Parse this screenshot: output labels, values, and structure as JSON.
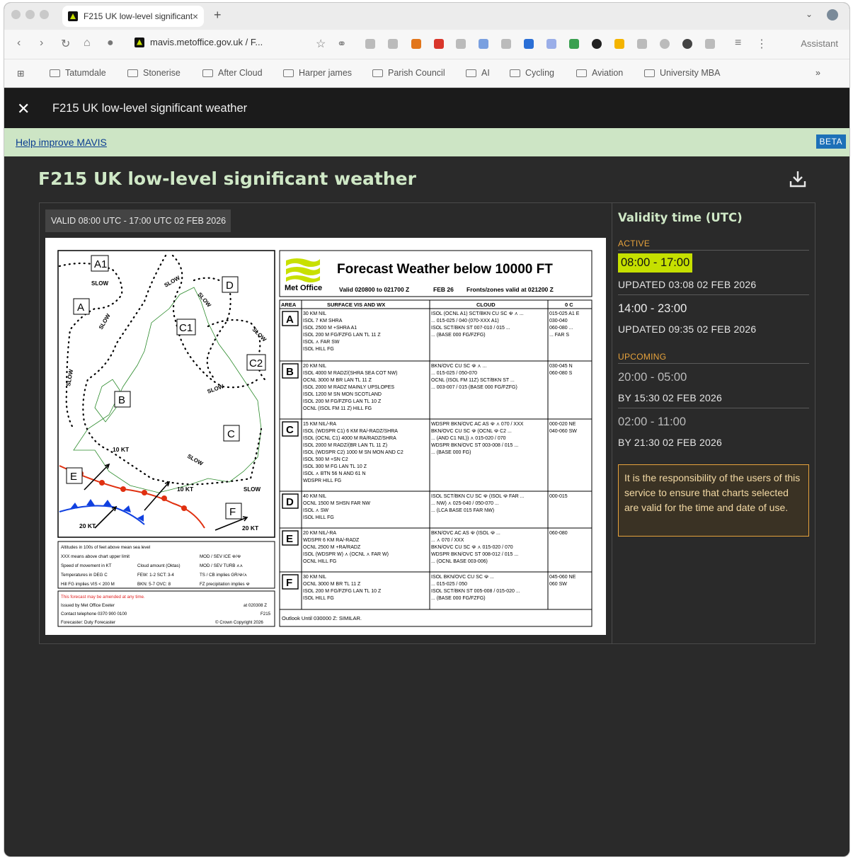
{
  "browser": {
    "tab_title": "F215 UK low-level significant",
    "url": "mavis.metoffice.gov.uk / F...",
    "assistant_label": "Assistant",
    "bookmarks": [
      "Tatumdale",
      "Stonerise",
      "After Cloud",
      "Harper james",
      "Parish Council",
      "AI",
      "Cycling",
      "Aviation",
      "University MBA"
    ]
  },
  "appbar": {
    "title": "F215 UK low-level significant weather"
  },
  "help": {
    "link": "Help improve MAVIS",
    "beta": "BETA"
  },
  "page": {
    "title": "F215 UK low-level significant weather"
  },
  "chart": {
    "valid_badge": "VALID 08:00 UTC - 17:00 UTC 02 FEB 2026",
    "header_title": "Forecast Weather below 10000 FT",
    "logo_text": "Met Office",
    "valid_line": "Valid 020800 to 021700 Z",
    "date_code": "FEB 26",
    "fronts_line": "Fronts/zones valid at 021200 Z",
    "col_area": "AREA",
    "col_vis": "SURFACE VIS AND WX",
    "col_cloud": "CLOUD",
    "col_zero": "0 C",
    "rows": [
      {
        "area": "A",
        "vis": [
          "30 KM NIL",
          "ISOL 7 KM SHRA",
          "ISOL 2500 M +SHRA A1",
          "ISOL 200 M FG/FZFG LAN TL 11 Z",
          "ISOL ⋏ FAR SW",
          "ISOL HILL FG"
        ],
        "cloud": [
          "ISOL (OCNL A1) SCT/BKN CU SC ☫ ⋏ ...",
          "... 015-025 / 040 (070-XXX A1)",
          "ISOL SCT/BKN ST 007-010 / 015 ...",
          "... (BASE 000 FG/FZFG)"
        ],
        "zero": [
          "015-025 A1 E",
          "030-040",
          "060-080 ...",
          "... FAR S"
        ]
      },
      {
        "area": "B",
        "vis": [
          "20 KM NIL",
          "ISOL 4000 M RADZ/(SHRA SEA COT NW)",
          "OCNL 3000 M BR LAN TL 11 Z",
          "ISOL 2000 M RADZ MAINLY UPSLOPES",
          "ISOL 1200 M SN MON SCOTLAND",
          "ISOL 200 M FG/FZFG LAN TL 10 Z",
          "OCNL (ISOL FM 11 Z) HILL FG"
        ],
        "cloud": [
          "BKN/OVC CU SC ☫ ⋏ ...",
          "... 015-025 / 050-070",
          "OCNL (ISOL FM 11Z) SCT/BKN ST ...",
          "... 003-007 / 015 (BASE 000 FG/FZFG)"
        ],
        "zero": [
          "030-045 N",
          "060-080 S"
        ]
      },
      {
        "area": "C",
        "vis": [
          "15 KM NIL/-RA",
          "ISOL (WDSPR C1) 6 KM RA/-RADZ/SHRA",
          "ISOL (OCNL C1) 4000 M RA/RADZ/SHRA",
          "ISOL 2000 M RADZ/(BR LAN TL 11 Z)",
          "ISOL (WDSPR C2) 1000 M SN MON AND C2",
          "ISOL 500 M +SN C2",
          "ISOL 300 M FG LAN TL 10 Z",
          "ISOL ⋏ BTN 56 N AND 61 N",
          "WDSPR HILL FG"
        ],
        "cloud": [
          "WDSPR BKN/OVC AC AS ☫ ⋏ 070 / XXX",
          "BKN/OVC CU SC ☫ (OCNL ☫ C2 ...",
          "... (AND C1 NIL)) ⋏ 015-020 / 070",
          "WDSPR BKN/OVC ST 003-008 / 015 ...",
          "... (BASE 000 FG)"
        ],
        "zero": [
          "000-020 NE",
          "040-060 SW"
        ]
      },
      {
        "area": "D",
        "vis": [
          "40 KM NIL",
          "OCNL 1500 M SHSN FAR NW",
          "ISOL ⋏ SW",
          "ISOL HILL FG"
        ],
        "cloud": [
          "ISOL SCT/BKN CU SC ☫ (ISOL ☫ FAR ...",
          "... NW) ⋏ 025-040 / 050-070 ...",
          "... (LCA BASE 015 FAR NW)"
        ],
        "zero": [
          "000-015"
        ]
      },
      {
        "area": "E",
        "vis": [
          "20 KM NIL/-RA",
          "WDSPR 6 KM RA/-RADZ",
          "OCNL 2500 M +RA/RADZ",
          "ISOL (WDSPR W) ⋏ (OCNL ⋏ FAR W)",
          "OCNL HILL FG"
        ],
        "cloud": [
          "BKN/OVC AC AS ☫ (ISOL ☫ ...",
          "... ⋏ 070 / XXX",
          "BKN/OVC CU SC ☫ ⋏ 015-020 / 070",
          "WDSPR BKN/OVC ST 008-012 / 015 ...",
          "... (OCNL BASE 003-006)"
        ],
        "zero": [
          "060-080"
        ]
      },
      {
        "area": "F",
        "vis": [
          "30 KM NIL",
          "OCNL 3000 M BR TL 11 Z",
          "ISOL 200 M FG/FZFG LAN TL 10 Z",
          "ISOL HILL FG"
        ],
        "cloud": [
          "ISOL BKN/OVC CU SC ☫ ...",
          "... 015-025 / 050",
          "ISOL SCT/BKN ST 005-008 / 015-020 ...",
          "... (BASE 000 FG/FZFG)"
        ],
        "zero": [
          "045-060 NE",
          "060 SW"
        ]
      }
    ],
    "outlook": "Outlook Until 030000 Z: SIMILAR.",
    "map_labels": [
      "A1",
      "A",
      "B",
      "C",
      "C1",
      "C2",
      "D",
      "E",
      "F"
    ],
    "slow": "SLOW",
    "wind_labels": [
      "10 KT",
      "10 KT",
      "20 KT",
      "20 KT"
    ],
    "key_lines": [
      "Altitudes in 100s of feet above mean sea level",
      "XXX means above chart upper limit",
      "Speed of movement in KT",
      "Temperatures in DEG C",
      "Hill FG implies VIS < 200 M"
    ],
    "key_right": [
      "MOD / SEV ICE ☫/☫",
      "MOD / SEV TURB ⋏⋏",
      "TS / CB implies GR/☫/⋏",
      "FZ precipitation implies ☫"
    ],
    "key_mid": [
      "Cloud amount (Oktas)",
      "FEW: 1-2 SCT: 3-4",
      "BKN: 5-7 OVC: 8"
    ],
    "amend": "This forecast may be amended at any time.",
    "issued": "Issued by Met Office Exeter",
    "issued_time": "at 020308 Z",
    "contact": "Contact telephone 0370 900 0100",
    "code": "F215",
    "forecaster": "Forecaster: Duty Forecaster",
    "copyright": "© Crown Copyright 2026"
  },
  "sidebar": {
    "heading": "Validity time (UTC)",
    "active_label": "ACTIVE",
    "upcoming_label": "UPCOMING",
    "slots": [
      {
        "time": "08:00 - 17:00",
        "sub": "UPDATED 03:08 02 FEB 2026"
      },
      {
        "time": "14:00 - 23:00",
        "sub": "UPDATED 09:35 02 FEB 2026"
      },
      {
        "time": "20:00 - 05:00",
        "sub": "BY 15:30 02 FEB 2026"
      },
      {
        "time": "02:00 - 11:00",
        "sub": "BY 21:30 02 FEB 2026"
      }
    ],
    "notice": "It is the responsibility of the users of this service to ensure that charts selected are valid for the time and date of use."
  },
  "colors": {
    "accent": "#c6e000",
    "heading": "#cfe8c6",
    "warning": "#e6a23c",
    "beta": "#1d70b8"
  }
}
